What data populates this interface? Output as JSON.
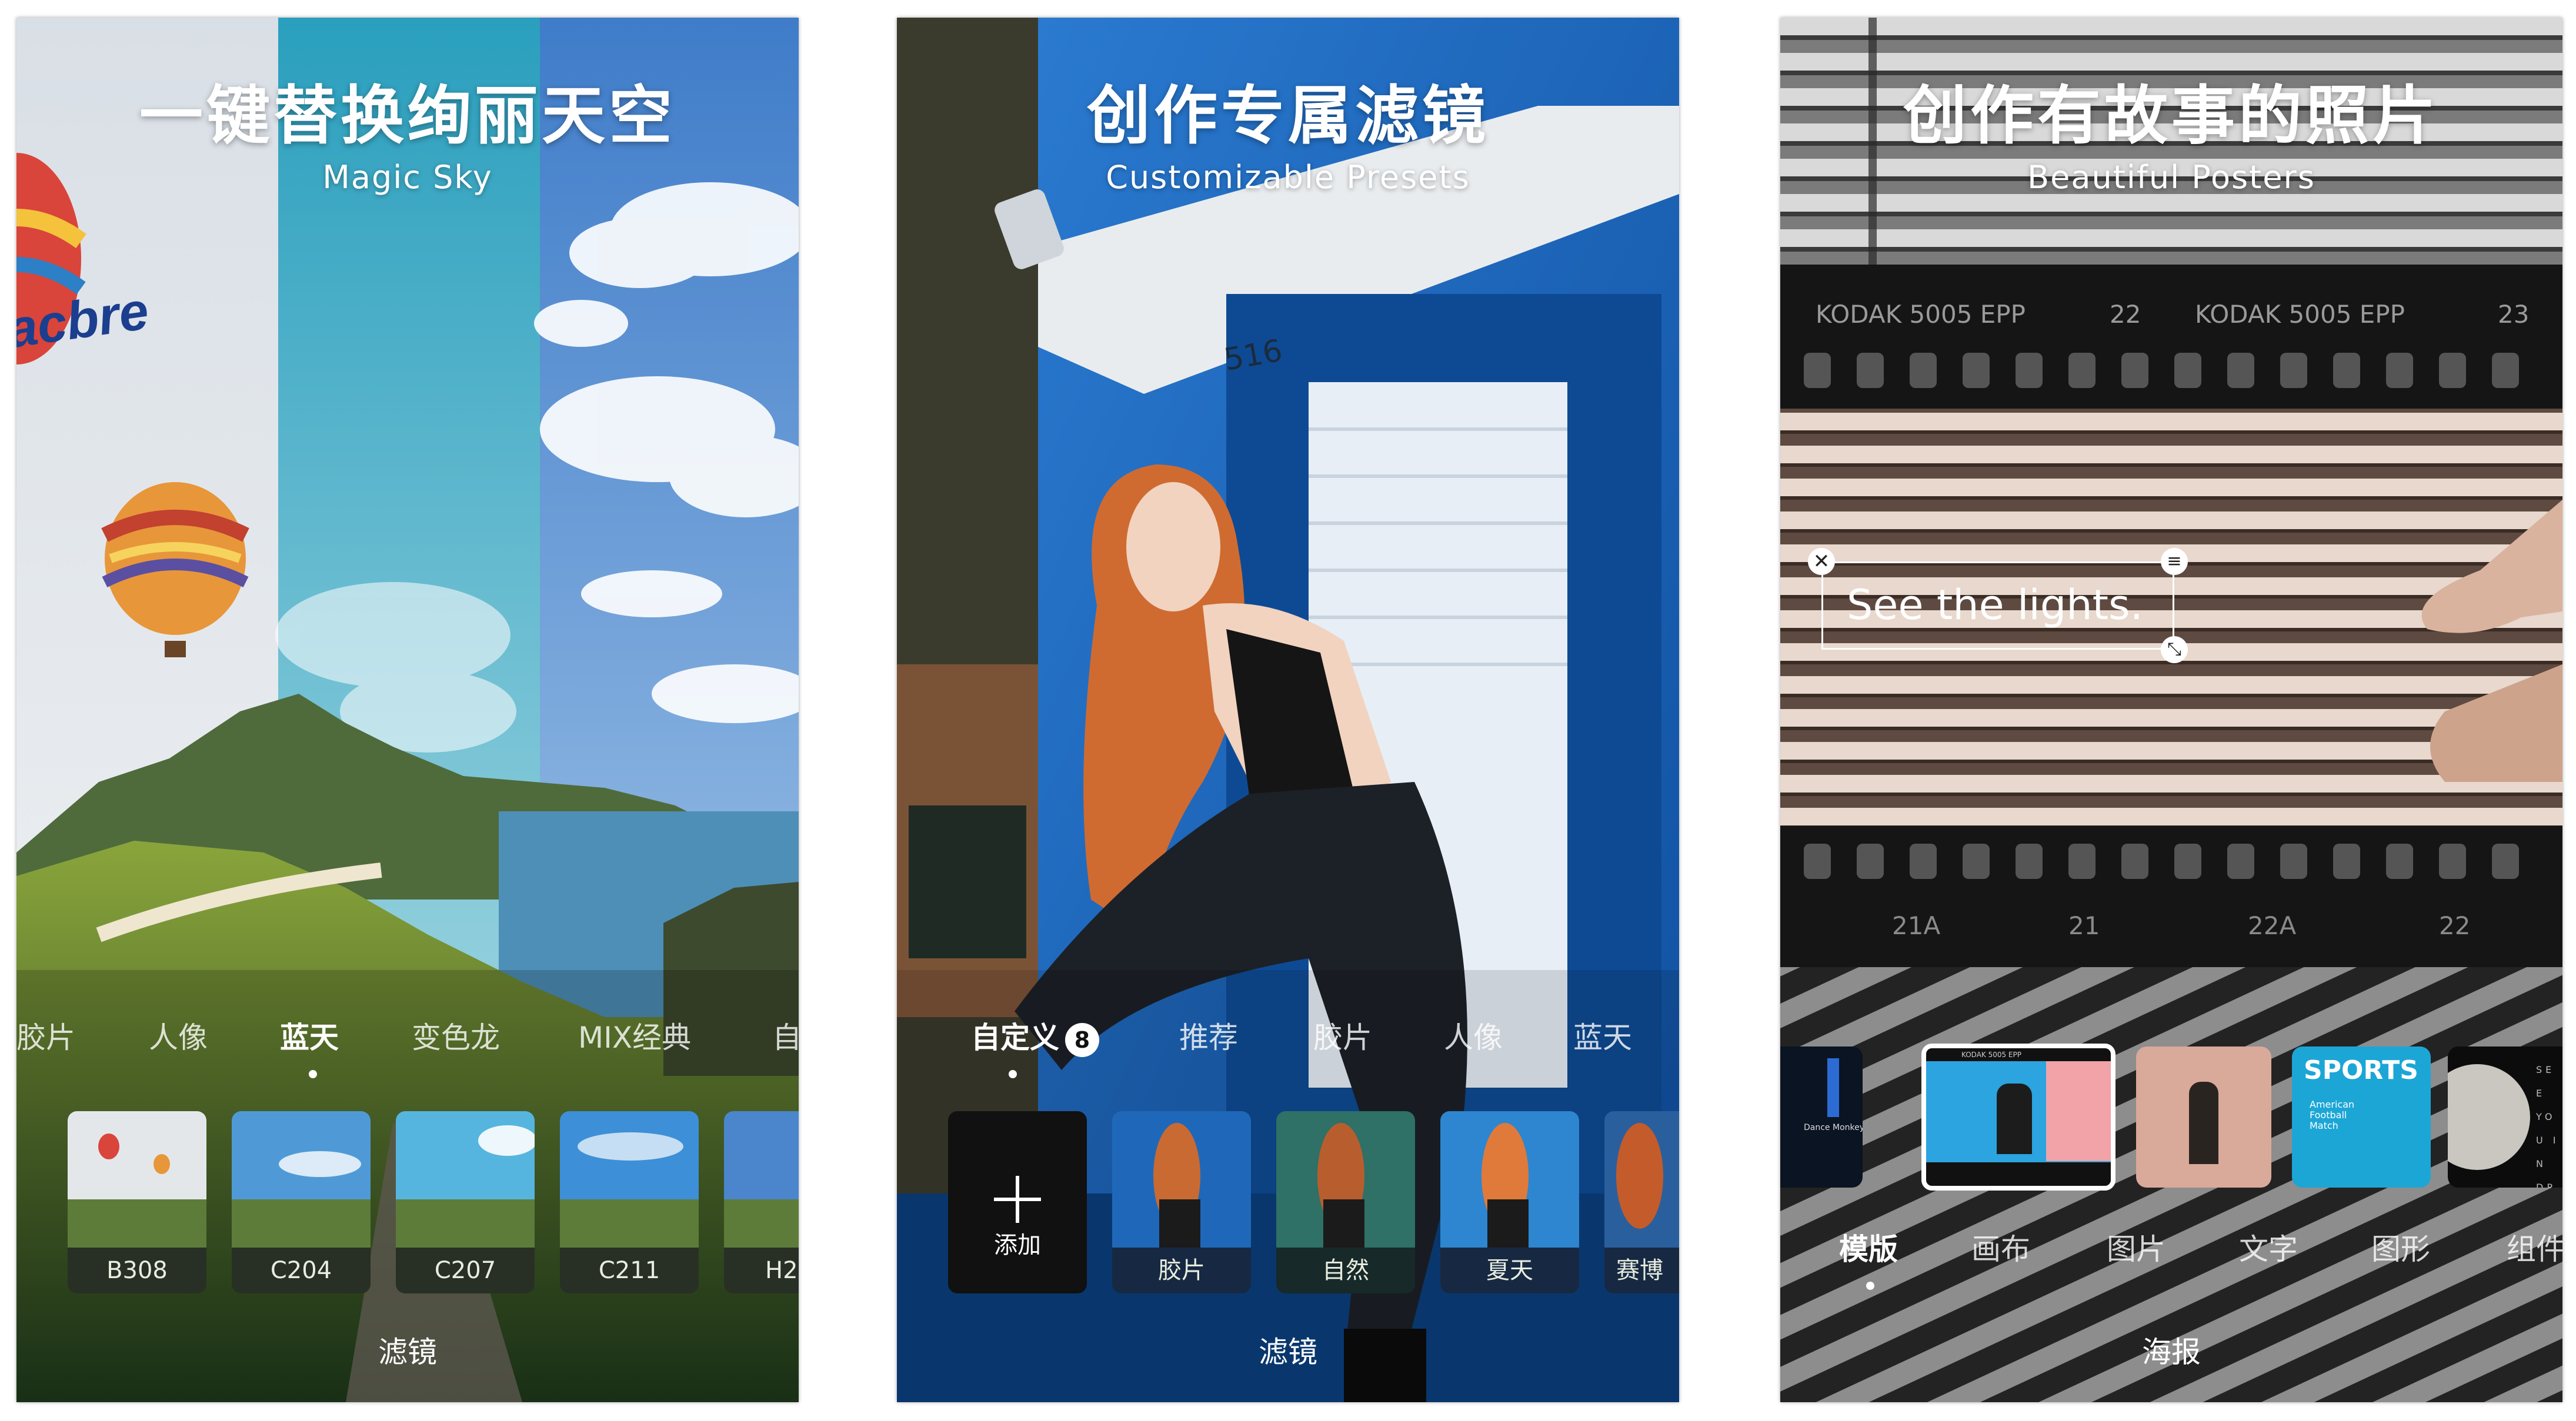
{
  "panels": [
    {
      "title": "一键替换绚丽天空",
      "subtitle": "Magic Sky",
      "categories": [
        "胶片",
        "人像",
        "蓝天",
        "变色龙",
        "MIX经典",
        "自"
      ],
      "active_category": "蓝天",
      "filters": [
        "B308",
        "C204",
        "C207",
        "C211",
        "H2"
      ],
      "caption": "滤镜",
      "balloon_text": "acbre"
    },
    {
      "title": "创作专属滤镜",
      "subtitle": "Customizable Presets",
      "categories": [
        "自定义",
        "推荐",
        "胶片",
        "人像",
        "蓝天"
      ],
      "active_category": "自定义",
      "custom_count": "8",
      "add_label": "添加",
      "presets": [
        "胶片",
        "自然",
        "夏天",
        "赛博"
      ],
      "caption": "滤镜",
      "door_number": "516"
    },
    {
      "title": "创作有故事的照片",
      "subtitle": "Beautiful Posters",
      "film_top_left": "KODAK 5005 EPP",
      "film_top_left_num": "22",
      "film_top_right": "KODAK 5005 EPP",
      "film_top_right_num": "23",
      "film_bottom": [
        "21A",
        "21",
        "22A",
        "22"
      ],
      "overlay_text": "See the lights.",
      "template_sports": "SPORTS",
      "template_sports_sub": "American Football Match",
      "template_dance": "Dance Monkey",
      "template_moon": "SEE YOU IN DREAMS",
      "template_kodak": "KODAK 5005 EPP",
      "tools": [
        "模版",
        "画布",
        "图片",
        "文字",
        "图形",
        "组件"
      ],
      "active_tool": "模版",
      "caption": "海报"
    }
  ],
  "colors": {
    "blue_wall": "#1a63b8",
    "sky": "#7fb7e3",
    "hair": "#d2692f",
    "film_dark": "#151515"
  }
}
